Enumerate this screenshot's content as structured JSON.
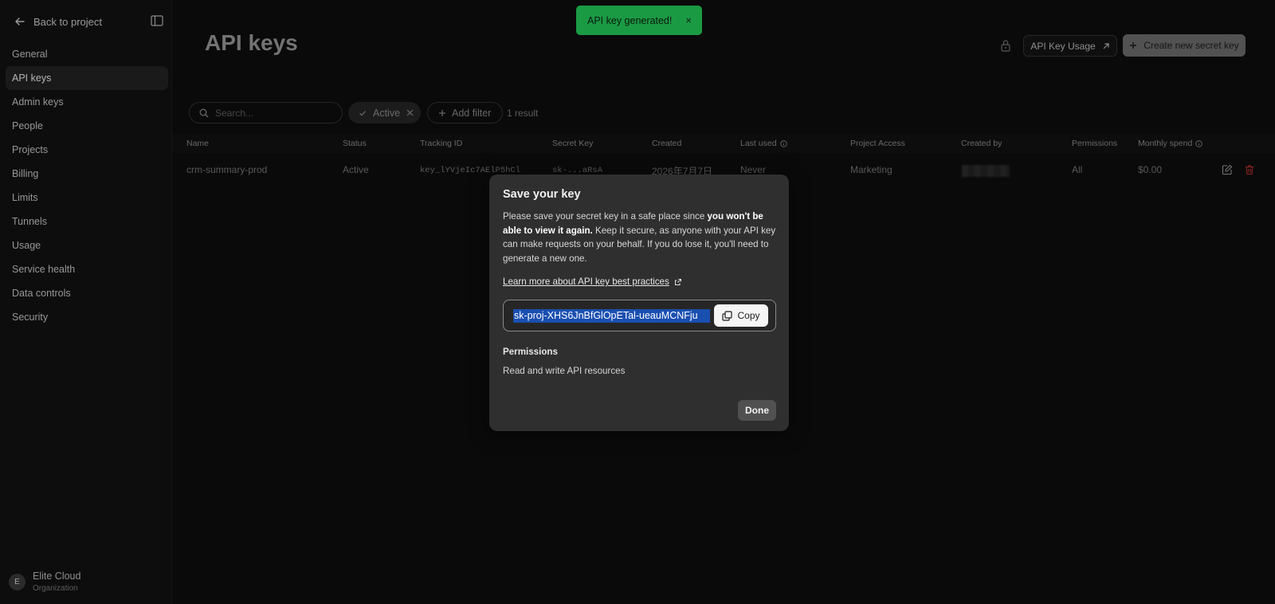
{
  "sidebar": {
    "back_label": "Back to project",
    "items": [
      {
        "label": "General"
      },
      {
        "label": "API keys",
        "active": true
      },
      {
        "label": "Admin keys"
      },
      {
        "label": "People"
      },
      {
        "label": "Projects"
      },
      {
        "label": "Billing"
      },
      {
        "label": "Limits"
      },
      {
        "label": "Tunnels"
      },
      {
        "label": "Usage"
      },
      {
        "label": "Service health"
      },
      {
        "label": "Data controls"
      },
      {
        "label": "Security"
      }
    ],
    "org": {
      "initial": "E",
      "name": "Elite Cloud",
      "type": "Organization"
    }
  },
  "header": {
    "title": "API keys",
    "usage_button": "API Key Usage",
    "create_button": "Create new secret key"
  },
  "filters": {
    "search_placeholder": "Search...",
    "active_chip": "Active",
    "add_filter": "Add filter",
    "result_count": "1 result"
  },
  "table": {
    "columns": [
      "Name",
      "Status",
      "Tracking ID",
      "Secret Key",
      "Created",
      "Last used",
      "Project Access",
      "Created by",
      "Permissions",
      "Monthly spend"
    ],
    "rows": [
      {
        "name": "crm-summary-prod",
        "status": "Active",
        "tracking_id": "key_lYVjeIc7AElP5hCl",
        "secret_key": "sk-...aRsA",
        "created": "2026年7月7日",
        "last_used": "Never",
        "project_access": "Marketing",
        "permissions": "All",
        "monthly_spend": "$0.00"
      }
    ]
  },
  "toast": {
    "message": "API key generated!",
    "close": "×"
  },
  "modal": {
    "title": "Save your key",
    "text_before": "Please save your secret key in a safe place since ",
    "text_bold": "you won't be able to view it again.",
    "text_after": " Keep it secure, as anyone with your API key can make requests on your behalf. If you do lose it, you'll need to generate a new one.",
    "link": "Learn more about API key best practices",
    "key_value": "sk-proj-XHS6JnBfGlOpETal-ueauMCNFju",
    "copy_label": "Copy",
    "permissions_label": "Permissions",
    "permissions_value": "Read and write API resources",
    "done_label": "Done"
  },
  "colors": {
    "toast_bg": "#1b9a44",
    "key_highlight": "#1a4fb0",
    "delete_icon": "#c0392b"
  }
}
